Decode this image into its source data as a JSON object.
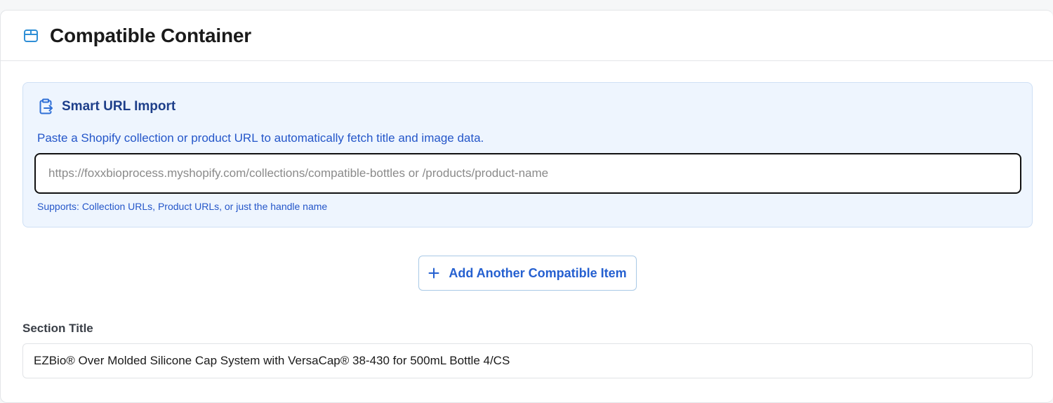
{
  "card": {
    "title": "Compatible Container",
    "icon": "box-icon"
  },
  "smart_import": {
    "title": "Smart URL Import",
    "icon": "clipboard-import-icon",
    "description": "Paste a Shopify collection or product URL to automatically fetch title and image data.",
    "url_input": {
      "value": "",
      "placeholder": "https://foxxbioprocess.myshopify.com/collections/compatible-bottles or /products/product-name"
    },
    "hint": "Supports: Collection URLs, Product URLs, or just the handle name"
  },
  "add_button": {
    "label": "Add Another Compatible Item",
    "icon": "plus-icon"
  },
  "section_title": {
    "label": "Section Title",
    "value": "EZBio® Over Molded Silicone Cap System with VersaCap® 38-430 for 500mL Bottle 4/CS"
  },
  "colors": {
    "accent": "#2560d0",
    "import_bg": "#eef5fe",
    "import_title": "#1e3f8a",
    "import_text": "#2456c9"
  }
}
